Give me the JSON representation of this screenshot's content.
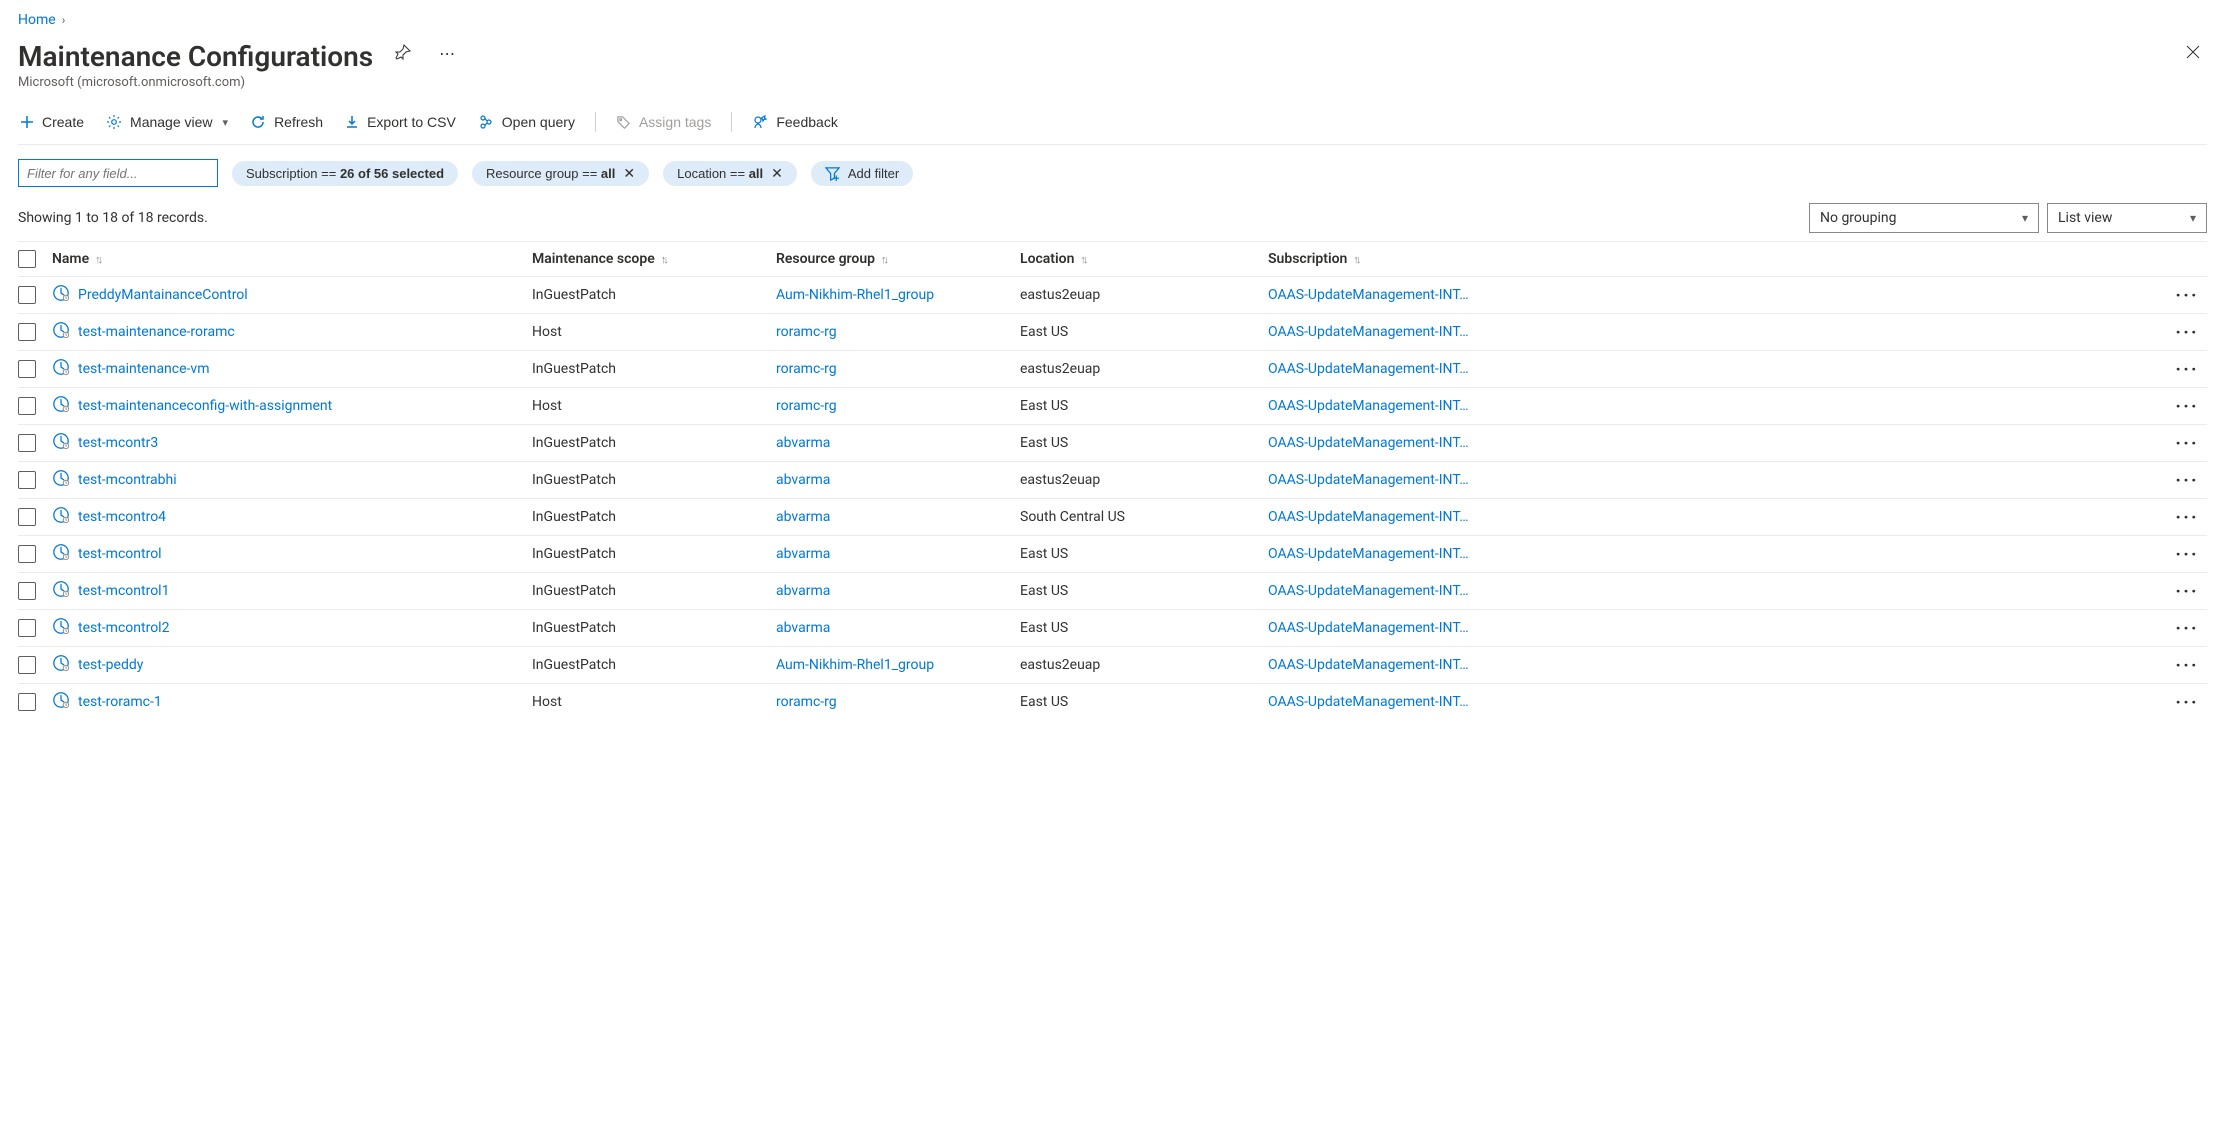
{
  "breadcrumb": {
    "home": "Home"
  },
  "title": "Maintenance Configurations",
  "subtitle": "Microsoft (microsoft.onmicrosoft.com)",
  "toolbar": {
    "create": "Create",
    "manageView": "Manage view",
    "refresh": "Refresh",
    "exportCsv": "Export to CSV",
    "openQuery": "Open query",
    "assignTags": "Assign tags",
    "feedback": "Feedback"
  },
  "filters": {
    "inputPlaceholder": "Filter for any field...",
    "subscription": {
      "prefix": "Subscription == ",
      "value": "26 of 56 selected"
    },
    "resourceGroup": {
      "prefix": "Resource group == ",
      "value": "all"
    },
    "location": {
      "prefix": "Location == ",
      "value": "all"
    },
    "addFilter": "Add filter"
  },
  "status": "Showing 1 to 18 of 18 records.",
  "grouping": {
    "value": "No grouping"
  },
  "viewMode": {
    "value": "List view"
  },
  "columns": {
    "name": "Name",
    "scope": "Maintenance scope",
    "rg": "Resource group",
    "location": "Location",
    "subscription": "Subscription"
  },
  "subscriptionDisplay": "OAAS-UpdateManagement-INT…",
  "rows": [
    {
      "name": "PreddyMantainanceControl",
      "scope": "InGuestPatch",
      "rg": "Aum-Nikhim-Rhel1_group",
      "location": "eastus2euap"
    },
    {
      "name": "test-maintenance-roramc",
      "scope": "Host",
      "rg": "roramc-rg",
      "location": "East US"
    },
    {
      "name": "test-maintenance-vm",
      "scope": "InGuestPatch",
      "rg": "roramc-rg",
      "location": "eastus2euap"
    },
    {
      "name": "test-maintenanceconfig-with-assignment",
      "scope": "Host",
      "rg": "roramc-rg",
      "location": "East US"
    },
    {
      "name": "test-mcontr3",
      "scope": "InGuestPatch",
      "rg": "abvarma",
      "location": "East US"
    },
    {
      "name": "test-mcontrabhi",
      "scope": "InGuestPatch",
      "rg": "abvarma",
      "location": "eastus2euap"
    },
    {
      "name": "test-mcontro4",
      "scope": "InGuestPatch",
      "rg": "abvarma",
      "location": "South Central US"
    },
    {
      "name": "test-mcontrol",
      "scope": "InGuestPatch",
      "rg": "abvarma",
      "location": "East US"
    },
    {
      "name": "test-mcontrol1",
      "scope": "InGuestPatch",
      "rg": "abvarma",
      "location": "East US"
    },
    {
      "name": "test-mcontrol2",
      "scope": "InGuestPatch",
      "rg": "abvarma",
      "location": "East US"
    },
    {
      "name": "test-peddy",
      "scope": "InGuestPatch",
      "rg": "Aum-Nikhim-Rhel1_group",
      "location": "eastus2euap"
    },
    {
      "name": "test-roramc-1",
      "scope": "Host",
      "rg": "roramc-rg",
      "location": "East US"
    }
  ]
}
